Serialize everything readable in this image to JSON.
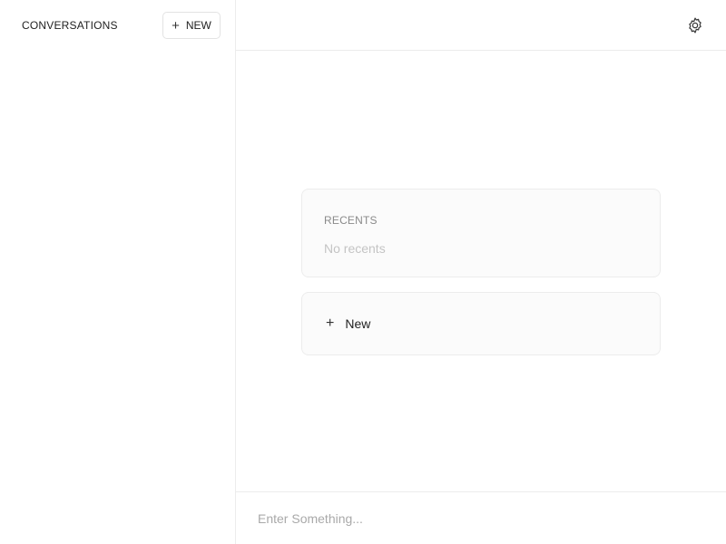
{
  "sidebar": {
    "title": "CONVERSATIONS",
    "new_button": {
      "icon": "plus-icon",
      "label": "NEW"
    }
  },
  "header": {
    "settings_icon": "gear-icon"
  },
  "main": {
    "recents": {
      "label": "RECENTS",
      "empty_text": "No recents"
    },
    "new_card": {
      "icon": "plus-icon",
      "label": "New"
    }
  },
  "input": {
    "value": "",
    "placeholder": "Enter Something..."
  },
  "colors": {
    "border": "#ececec",
    "card_bg": "#fbfbfb",
    "muted_text": "#8a8a8a",
    "placeholder_text": "#a9a9a9"
  }
}
